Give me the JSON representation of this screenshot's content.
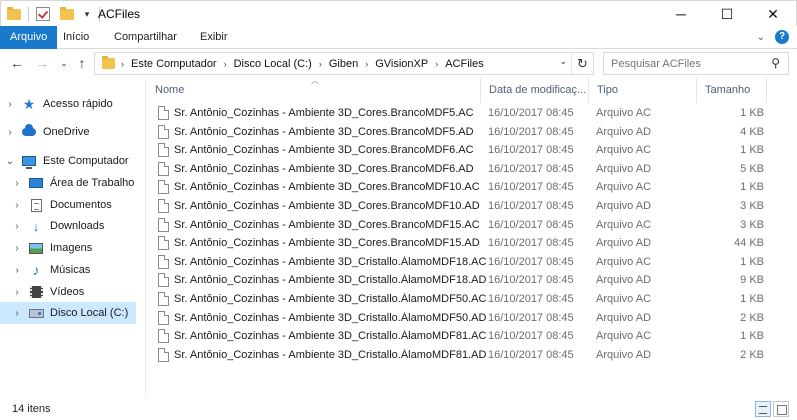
{
  "window": {
    "title": "ACFiles",
    "buttons": {
      "minimize": "─",
      "maximize": "☐",
      "close": "✕"
    }
  },
  "ribbon": {
    "tabs": [
      {
        "label": "Arquivo",
        "active": true
      },
      {
        "label": "Início",
        "active": false
      },
      {
        "label": "Compartilhar",
        "active": false
      },
      {
        "label": "Exibir",
        "active": false
      }
    ],
    "help": "?"
  },
  "address": {
    "crumbs": [
      "Este Computador",
      "Disco Local (C:)",
      "Giben",
      "GVisionXP",
      "ACFiles"
    ]
  },
  "search": {
    "placeholder": "Pesquisar ACFiles"
  },
  "sidebar": {
    "items": [
      {
        "label": "Acesso rápido",
        "icon": "star-icon"
      },
      {
        "label": "OneDrive",
        "icon": "cloud-icon"
      },
      {
        "label": "Este Computador",
        "icon": "computer-icon"
      },
      {
        "label": "Área de Trabalho",
        "icon": "desktop-icon"
      },
      {
        "label": "Documentos",
        "icon": "documents-icon"
      },
      {
        "label": "Downloads",
        "icon": "download-icon"
      },
      {
        "label": "Imagens",
        "icon": "pictures-icon"
      },
      {
        "label": "Músicas",
        "icon": "music-icon"
      },
      {
        "label": "Vídeos",
        "icon": "videos-icon"
      },
      {
        "label": "Disco Local (C:)",
        "icon": "drive-icon",
        "selected": true
      }
    ]
  },
  "columns": {
    "name": "Nome",
    "date": "Data de modificaç...",
    "type": "Tipo",
    "size": "Tamanho"
  },
  "files": [
    {
      "name": "Sr. Antônio_Cozinhas - Ambiente 3D_Cores.BrancoMDF5.AC",
      "date": "16/10/2017 08:45",
      "type": "Arquivo AC",
      "size": "1 KB"
    },
    {
      "name": "Sr. Antônio_Cozinhas - Ambiente 3D_Cores.BrancoMDF5.AD",
      "date": "16/10/2017 08:45",
      "type": "Arquivo AD",
      "size": "4 KB"
    },
    {
      "name": "Sr. Antônio_Cozinhas - Ambiente 3D_Cores.BrancoMDF6.AC",
      "date": "16/10/2017 08:45",
      "type": "Arquivo AC",
      "size": "1 KB"
    },
    {
      "name": "Sr. Antônio_Cozinhas - Ambiente 3D_Cores.BrancoMDF6.AD",
      "date": "16/10/2017 08:45",
      "type": "Arquivo AD",
      "size": "5 KB"
    },
    {
      "name": "Sr. Antônio_Cozinhas - Ambiente 3D_Cores.BrancoMDF10.AC",
      "date": "16/10/2017 08:45",
      "type": "Arquivo AC",
      "size": "1 KB"
    },
    {
      "name": "Sr. Antônio_Cozinhas - Ambiente 3D_Cores.BrancoMDF10.AD",
      "date": "16/10/2017 08:45",
      "type": "Arquivo AD",
      "size": "3 KB"
    },
    {
      "name": "Sr. Antônio_Cozinhas - Ambiente 3D_Cores.BrancoMDF15.AC",
      "date": "16/10/2017 08:45",
      "type": "Arquivo AC",
      "size": "3 KB"
    },
    {
      "name": "Sr. Antônio_Cozinhas - Ambiente 3D_Cores.BrancoMDF15.AD",
      "date": "16/10/2017 08:45",
      "type": "Arquivo AD",
      "size": "44 KB"
    },
    {
      "name": "Sr. Antônio_Cozinhas - Ambiente 3D_Cristallo.ÁlamoMDF18.AC",
      "date": "16/10/2017 08:45",
      "type": "Arquivo AC",
      "size": "1 KB"
    },
    {
      "name": "Sr. Antônio_Cozinhas - Ambiente 3D_Cristallo.ÁlamoMDF18.AD",
      "date": "16/10/2017 08:45",
      "type": "Arquivo AD",
      "size": "9 KB"
    },
    {
      "name": "Sr. Antônio_Cozinhas - Ambiente 3D_Cristallo.ÁlamoMDF50.AC",
      "date": "16/10/2017 08:45",
      "type": "Arquivo AC",
      "size": "1 KB"
    },
    {
      "name": "Sr. Antônio_Cozinhas - Ambiente 3D_Cristallo.ÁlamoMDF50.AD",
      "date": "16/10/2017 08:45",
      "type": "Arquivo AD",
      "size": "2 KB"
    },
    {
      "name": "Sr. Antônio_Cozinhas - Ambiente 3D_Cristallo.ÁlamoMDF81.AC",
      "date": "16/10/2017 08:45",
      "type": "Arquivo AC",
      "size": "1 KB"
    },
    {
      "name": "Sr. Antônio_Cozinhas - Ambiente 3D_Cristallo.ÁlamoMDF81.AD",
      "date": "16/10/2017 08:45",
      "type": "Arquivo AD",
      "size": "2 KB"
    }
  ],
  "status": {
    "item_count": "14 itens"
  },
  "colors": {
    "accent": "#1979ca",
    "selection": "#cce8ff",
    "header_text": "#4c607a"
  }
}
